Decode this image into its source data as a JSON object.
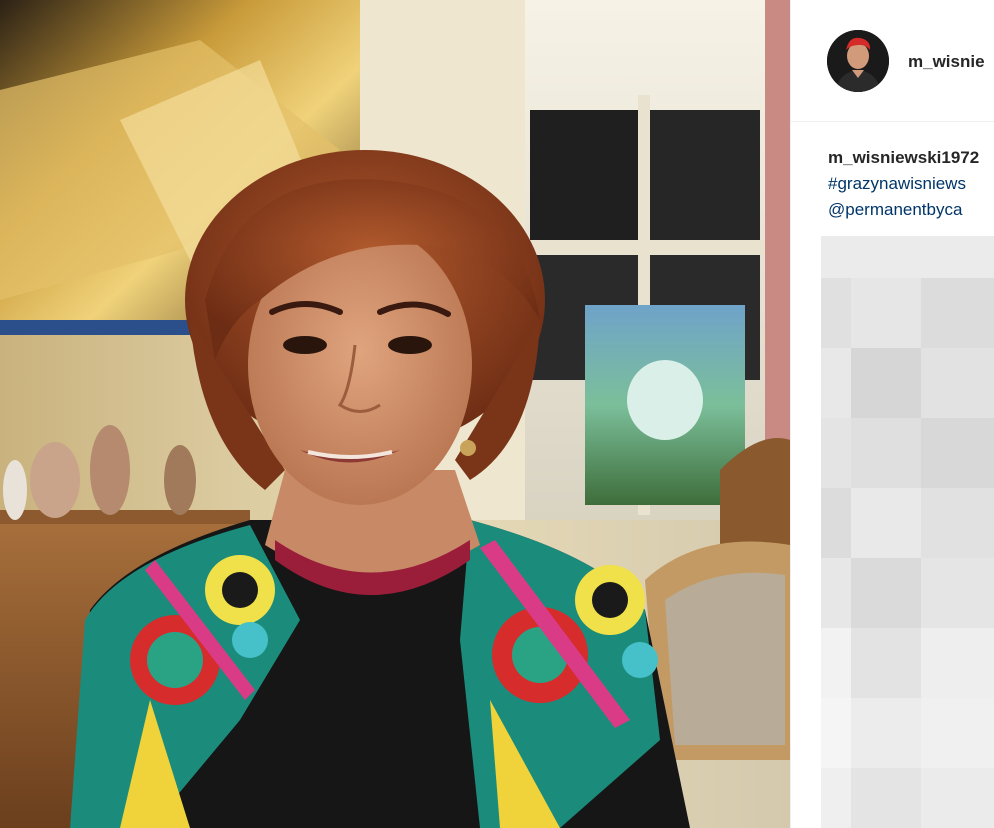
{
  "post": {
    "image_description": "",
    "author_username": "m_wisnie",
    "caption_author": "m_wisniewski1972",
    "caption_hashtag": "#grazynawisniews",
    "caption_mention": "@permanentbyca"
  },
  "colors": {
    "username_text": "#262626",
    "link_text": "#003569",
    "divider": "#efefef",
    "placeholder_gray": "#ebebeb"
  },
  "icons": {
    "avatar": "profile-avatar"
  }
}
